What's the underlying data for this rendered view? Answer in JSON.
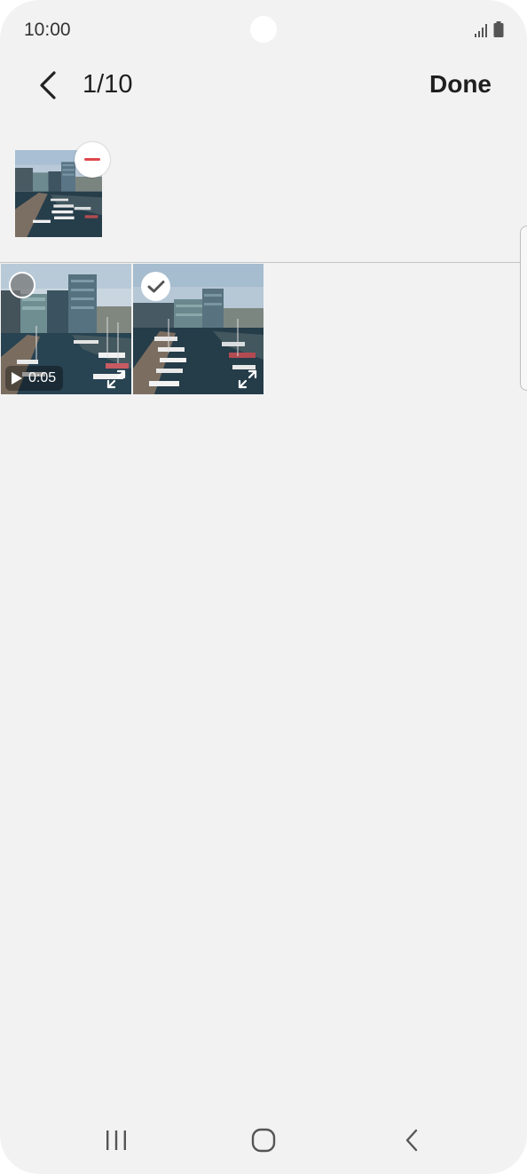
{
  "status_bar": {
    "time": "10:00",
    "icons": [
      "signal-icon",
      "battery-icon"
    ]
  },
  "header": {
    "back_icon": "back-arrow-icon",
    "counter": "1/10",
    "done_label": "Done"
  },
  "selected_tray": {
    "items": [
      {
        "type": "image",
        "remove_icon": "minus-icon"
      }
    ]
  },
  "grid": {
    "items": [
      {
        "type": "video",
        "duration": "0:05",
        "selected": false,
        "icons": [
          "play-icon",
          "expand-icon"
        ]
      },
      {
        "type": "image",
        "selected": true,
        "icons": [
          "checkmark-icon",
          "expand-icon"
        ]
      }
    ]
  },
  "navigation_bar": {
    "buttons": [
      "recent-apps-icon",
      "home-icon",
      "back-icon"
    ]
  },
  "colors": {
    "background": "#f2f2f2",
    "remove_accent": "#e0474c",
    "text": "#1f1f1f"
  }
}
